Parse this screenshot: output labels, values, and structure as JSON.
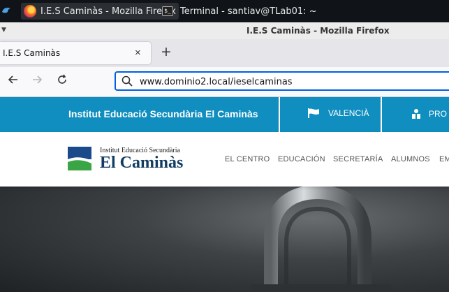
{
  "taskbar": {
    "items": [
      {
        "label": "I.E.S Caminàs - Mozilla Firefox",
        "icon": "firefox-icon"
      },
      {
        "label": "Terminal - santiav@TLab01: ~",
        "icon": "terminal-icon"
      }
    ]
  },
  "window": {
    "title": "I.E.S Caminàs - Mozilla Firefox"
  },
  "tabs": [
    {
      "label": "I.E.S Caminàs"
    }
  ],
  "toolbar": {
    "url": "www.dominio2.local/ieselcaminas",
    "back_icon": "arrow-left-icon",
    "forward_icon": "arrow-right-icon",
    "reload_icon": "reload-icon"
  },
  "site": {
    "topbar": {
      "school_name": "Institut Educació Secundària El Caminàs",
      "language_label": "VALENCIÀ",
      "profile_label": "PRO"
    },
    "logo": {
      "small_text": "Institut Educació Secundària",
      "big_text": "El Caminàs"
    },
    "menu": [
      "EL CENTRO",
      "EDUCACIÓN",
      "SECRETARÍA",
      "ALUMNOS",
      "EM"
    ],
    "colors": {
      "topbar": "#0f8ebf",
      "logo_blue": "#1a4a8a",
      "logo_green": "#3aa544"
    }
  }
}
